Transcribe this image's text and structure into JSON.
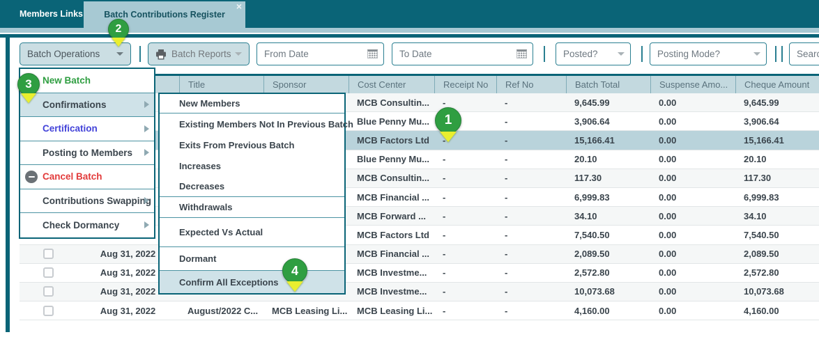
{
  "window": {
    "tabs": [
      {
        "label": "Members Links"
      },
      {
        "label": "Batch Contributions Register",
        "close_icon": "×"
      }
    ]
  },
  "toolbar": {
    "batch_operations_label": "Batch Operations",
    "batch_reports_label": "Batch Reports",
    "from_date_placeholder": "From Date",
    "to_date_placeholder": "To Date",
    "posted_placeholder": "Posted?",
    "posting_mode_placeholder": "Posting Mode?",
    "search_placeholder": "Search"
  },
  "batch_operations_menu": {
    "items": [
      {
        "label": "New Batch",
        "style": "green",
        "arrow": false
      },
      {
        "label": "Confirmations",
        "arrow": true,
        "highlighted": true
      },
      {
        "label": "Certification",
        "style": "blue",
        "arrow": true
      },
      {
        "label": "Posting to Members",
        "arrow": true
      },
      {
        "label": "Cancel Batch",
        "style": "red",
        "arrow": false,
        "icon": "cancel-circle"
      },
      {
        "label": "Contributions Swapping",
        "arrow": true
      },
      {
        "label": "Check Dormancy",
        "arrow": true
      }
    ]
  },
  "confirmations_submenu": {
    "items": [
      {
        "label": "New Members"
      },
      {
        "label": "Existing Members Not In Previous Batch"
      },
      {
        "label": "Exits From Previous Batch"
      },
      {
        "label": "Increases"
      },
      {
        "label": "Decreases"
      },
      {
        "label": "Withdrawals"
      },
      {
        "label": "Expected Vs Actual"
      },
      {
        "label": "Dormant"
      },
      {
        "label": "Confirm All Exceptions",
        "highlighted": true
      }
    ]
  },
  "register_table": {
    "headers": [
      "",
      "",
      "Title",
      "Sponsor",
      "Cost Center",
      "Receipt No",
      "Ref No",
      "Batch Total",
      "Suspense Amo...",
      "Cheque Amount"
    ],
    "rows": [
      {
        "checkbox": false,
        "date": "",
        "title": "",
        "sponsor": "",
        "cost_center": "MCB Consultin...",
        "receipt_no": "-",
        "ref_no": "-",
        "batch_total": "9,645.99",
        "suspense_amount": "0.00",
        "cheque_amount": "9,645.99",
        "highlighted": false
      },
      {
        "checkbox": false,
        "date": "",
        "title": "",
        "sponsor": "",
        "cost_center": "Blue Penny Mu...",
        "receipt_no": "-",
        "ref_no": "-",
        "batch_total": "3,906.64",
        "suspense_amount": "0.00",
        "cheque_amount": "3,906.64",
        "highlighted": false
      },
      {
        "checkbox": false,
        "date": "",
        "title": "",
        "sponsor": "",
        "cost_center": "MCB Factors Ltd",
        "receipt_no": "-",
        "ref_no": "-",
        "batch_total": "15,166.41",
        "suspense_amount": "0.00",
        "cheque_amount": "15,166.41",
        "highlighted": true
      },
      {
        "checkbox": false,
        "date": "",
        "title": "",
        "sponsor": "",
        "cost_center": "Blue Penny Mu...",
        "receipt_no": "-",
        "ref_no": "-",
        "batch_total": "20.10",
        "suspense_amount": "0.00",
        "cheque_amount": "20.10",
        "highlighted": false
      },
      {
        "checkbox": false,
        "date": "",
        "title": "",
        "sponsor": "",
        "cost_center": "MCB Consultin...",
        "receipt_no": "-",
        "ref_no": "-",
        "batch_total": "117.30",
        "suspense_amount": "0.00",
        "cheque_amount": "117.30",
        "highlighted": false
      },
      {
        "checkbox": false,
        "date": "",
        "title": "",
        "sponsor": "",
        "cost_center": "MCB Financial ...",
        "receipt_no": "-",
        "ref_no": "-",
        "batch_total": "6,999.83",
        "suspense_amount": "0.00",
        "cheque_amount": "6,999.83",
        "highlighted": false
      },
      {
        "checkbox": false,
        "date": "",
        "title": "",
        "sponsor": "",
        "cost_center": "MCB Forward ...",
        "receipt_no": "-",
        "ref_no": "-",
        "batch_total": "34.10",
        "suspense_amount": "0.00",
        "cheque_amount": "34.10",
        "highlighted": false
      },
      {
        "checkbox": false,
        "date": "",
        "title": "",
        "sponsor": "",
        "cost_center": "MCB Factors Ltd",
        "receipt_no": "-",
        "ref_no": "-",
        "batch_total": "7,540.50",
        "suspense_amount": "0.00",
        "cheque_amount": "7,540.50",
        "highlighted": false
      },
      {
        "checkbox": true,
        "date": "Aug 31, 2022",
        "title": "",
        "sponsor": "",
        "cost_center": "MCB Financial ...",
        "receipt_no": "-",
        "ref_no": "-",
        "batch_total": "2,089.50",
        "suspense_amount": "0.00",
        "cheque_amount": "2,089.50",
        "highlighted": false
      },
      {
        "checkbox": true,
        "date": "Aug 31, 2022",
        "title": "",
        "sponsor": "",
        "cost_center": "MCB Investme...",
        "receipt_no": "-",
        "ref_no": "-",
        "batch_total": "2,572.80",
        "suspense_amount": "0.00",
        "cheque_amount": "2,572.80",
        "highlighted": false
      },
      {
        "checkbox": true,
        "date": "Aug 31, 2022",
        "title": "",
        "sponsor": "",
        "cost_center": "MCB Investme...",
        "receipt_no": "-",
        "ref_no": "-",
        "batch_total": "10,073.68",
        "suspense_amount": "0.00",
        "cheque_amount": "10,073.68",
        "highlighted": false
      },
      {
        "checkbox": true,
        "date": "Aug 31, 2022",
        "title": "August/2022 C...",
        "sponsor": "MCB Leasing Li...",
        "cost_center": "MCB Leasing Li...",
        "receipt_no": "-",
        "ref_no": "-",
        "batch_total": "4,160.00",
        "suspense_amount": "0.00",
        "cheque_amount": "4,160.00",
        "highlighted": false
      }
    ]
  },
  "annotations": {
    "badges": [
      "1",
      "2",
      "3",
      "4"
    ]
  },
  "colors": {
    "teal_dark": "#0a6477",
    "accent_border": "#2a7f91",
    "tab_active_bg": "#a7c9d3",
    "header_bg": "#c3d9df",
    "row_highlight": "#b9d3db",
    "menu_highlight": "#cfe2e8",
    "badge_green": "#2f9e41",
    "badge_arrow_yellow": "#e9ee2f",
    "text_green": "#2f9e41",
    "text_blue": "#4343d9",
    "text_red": "#e23b3b"
  }
}
